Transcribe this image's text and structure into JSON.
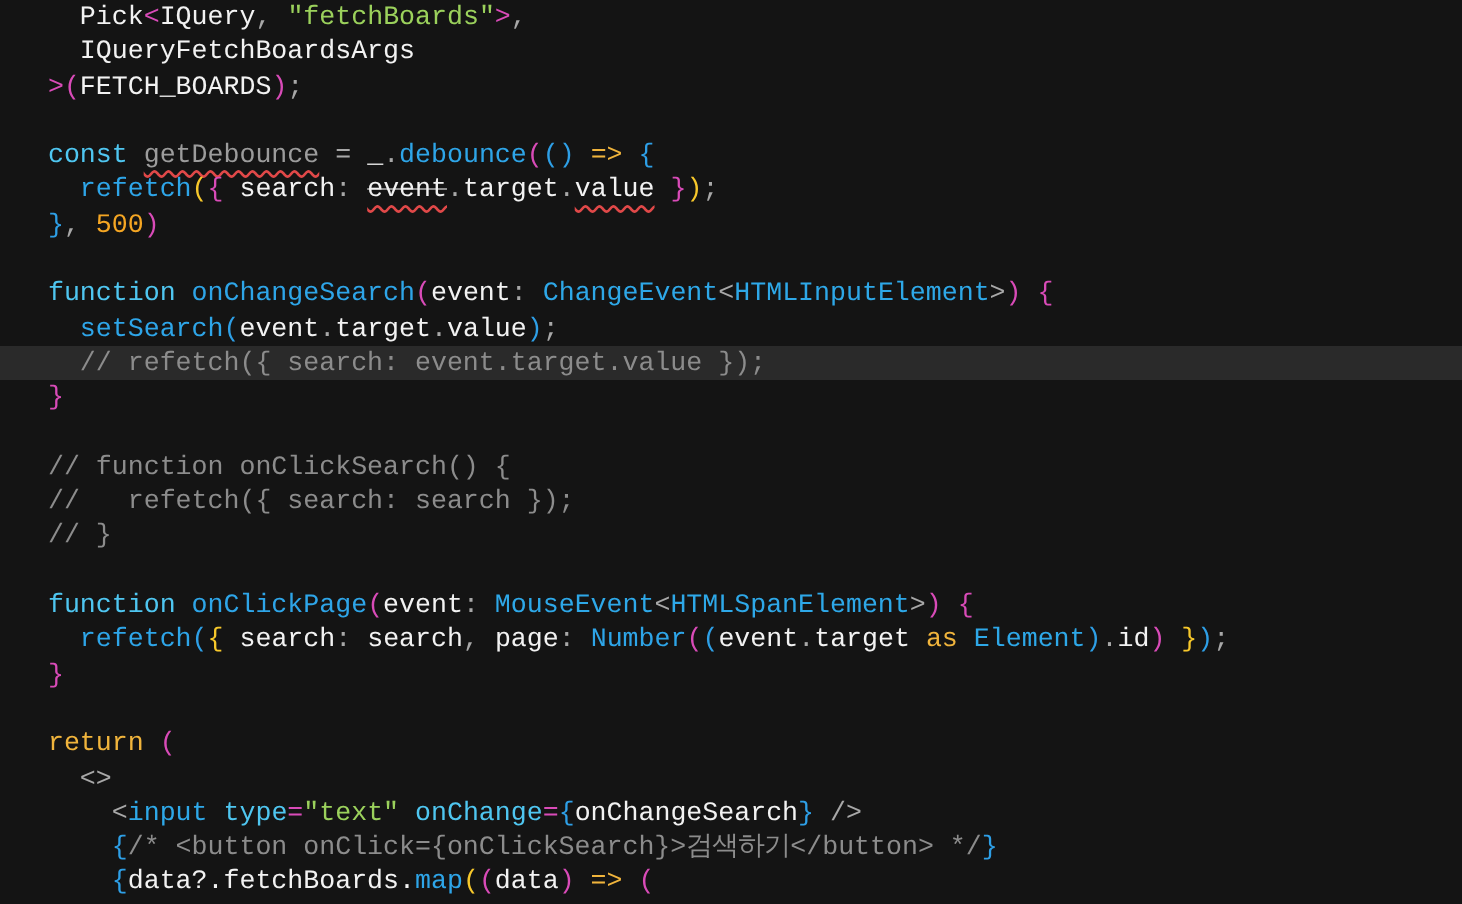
{
  "blocks": [
    {
      "lines": [
        {
          "highlighted": false,
          "tokens": [
            {
              "text": "    Pick",
              "kind": "var"
            },
            {
              "text": "<",
              "kind": "b2"
            },
            {
              "text": "IQuery",
              "kind": "var"
            },
            {
              "text": ", ",
              "kind": "punc"
            },
            {
              "text": "\"fetchBoards\"",
              "kind": "str"
            },
            {
              "text": ">",
              "kind": "b2"
            },
            {
              "text": ",",
              "kind": "punc"
            }
          ]
        },
        {
          "highlighted": false,
          "tokens": [
            {
              "text": "    IQueryFetchBoardsArgs",
              "kind": "var"
            }
          ]
        },
        {
          "highlighted": false,
          "tokens": [
            {
              "text": "  >(",
              "kind": "b2"
            },
            {
              "text": "FETCH_BOARDS",
              "kind": "var"
            },
            {
              "text": ")",
              "kind": "b2"
            },
            {
              "text": ";",
              "kind": "punc"
            }
          ]
        }
      ]
    },
    {
      "lines": [
        {
          "highlighted": false,
          "tokens": [
            {
              "text": "  const ",
              "kind": "kw"
            },
            {
              "text": "getDebounce",
              "kind": "unused",
              "error": true
            },
            {
              "text": " = ",
              "kind": "punc"
            },
            {
              "text": "_",
              "kind": "var"
            },
            {
              "text": ".",
              "kind": "punc"
            },
            {
              "text": "debounce",
              "kind": "fn"
            },
            {
              "text": "(",
              "kind": "b2"
            },
            {
              "text": "()",
              "kind": "b3"
            },
            {
              "text": " => ",
              "kind": "ctl"
            },
            {
              "text": "{",
              "kind": "b3"
            }
          ]
        },
        {
          "highlighted": false,
          "tokens": [
            {
              "text": "    refetch",
              "kind": "fn"
            },
            {
              "text": "(",
              "kind": "b1"
            },
            {
              "text": "{ ",
              "kind": "b2"
            },
            {
              "text": "search",
              "kind": "var"
            },
            {
              "text": ": ",
              "kind": "punc"
            },
            {
              "text": "event",
              "kind": "var",
              "error": true,
              "deprecated": true
            },
            {
              "text": ".",
              "kind": "punc"
            },
            {
              "text": "target",
              "kind": "var"
            },
            {
              "text": ".",
              "kind": "punc"
            },
            {
              "text": "value",
              "kind": "var",
              "error": true
            },
            {
              "text": " }",
              "kind": "b2"
            },
            {
              "text": ")",
              "kind": "b1"
            },
            {
              "text": ";",
              "kind": "punc"
            }
          ]
        },
        {
          "highlighted": false,
          "tokens": [
            {
              "text": "  }",
              "kind": "b3"
            },
            {
              "text": ", ",
              "kind": "punc"
            },
            {
              "text": "500",
              "kind": "num"
            },
            {
              "text": ")",
              "kind": "b2"
            }
          ]
        }
      ]
    },
    {
      "lines": [
        {
          "highlighted": false,
          "tokens": [
            {
              "text": "  function ",
              "kind": "kw"
            },
            {
              "text": "onChangeSearch",
              "kind": "fn"
            },
            {
              "text": "(",
              "kind": "b2"
            },
            {
              "text": "event",
              "kind": "var"
            },
            {
              "text": ": ",
              "kind": "punc"
            },
            {
              "text": "ChangeEvent",
              "kind": "type"
            },
            {
              "text": "<",
              "kind": "punc"
            },
            {
              "text": "HTMLInputElement",
              "kind": "type"
            },
            {
              "text": ">",
              "kind": "punc"
            },
            {
              "text": ") ",
              "kind": "b2"
            },
            {
              "text": "{",
              "kind": "b2"
            }
          ]
        },
        {
          "highlighted": false,
          "tokens": [
            {
              "text": "    setSearch",
              "kind": "fn"
            },
            {
              "text": "(",
              "kind": "b3"
            },
            {
              "text": "event",
              "kind": "var"
            },
            {
              "text": ".",
              "kind": "punc"
            },
            {
              "text": "target",
              "kind": "var"
            },
            {
              "text": ".",
              "kind": "punc"
            },
            {
              "text": "value",
              "kind": "var"
            },
            {
              "text": ")",
              "kind": "b3"
            },
            {
              "text": ";",
              "kind": "punc"
            }
          ]
        },
        {
          "highlighted": true,
          "tokens": [
            {
              "text": "    // refetch({ search: event.target.value });",
              "kind": "com"
            }
          ]
        },
        {
          "highlighted": false,
          "tokens": [
            {
              "text": "  }",
              "kind": "b2"
            }
          ]
        }
      ]
    },
    {
      "lines": [
        {
          "highlighted": false,
          "tokens": [
            {
              "text": "  // function onClickSearch() {",
              "kind": "com"
            }
          ]
        },
        {
          "highlighted": false,
          "tokens": [
            {
              "text": "  //   refetch({ search: search });",
              "kind": "com"
            }
          ]
        },
        {
          "highlighted": false,
          "tokens": [
            {
              "text": "  // }",
              "kind": "com"
            }
          ]
        }
      ]
    },
    {
      "lines": [
        {
          "highlighted": false,
          "tokens": [
            {
              "text": "  function ",
              "kind": "kw"
            },
            {
              "text": "onClickPage",
              "kind": "fn"
            },
            {
              "text": "(",
              "kind": "b2"
            },
            {
              "text": "event",
              "kind": "var"
            },
            {
              "text": ": ",
              "kind": "punc"
            },
            {
              "text": "MouseEvent",
              "kind": "type"
            },
            {
              "text": "<",
              "kind": "punc"
            },
            {
              "text": "HTMLSpanElement",
              "kind": "type"
            },
            {
              "text": ">",
              "kind": "punc"
            },
            {
              "text": ") ",
              "kind": "b2"
            },
            {
              "text": "{",
              "kind": "b2"
            }
          ]
        },
        {
          "highlighted": false,
          "tokens": [
            {
              "text": "    refetch",
              "kind": "fn"
            },
            {
              "text": "(",
              "kind": "b3"
            },
            {
              "text": "{ ",
              "kind": "b1"
            },
            {
              "text": "search",
              "kind": "var"
            },
            {
              "text": ": ",
              "kind": "punc"
            },
            {
              "text": "search",
              "kind": "var"
            },
            {
              "text": ", ",
              "kind": "punc"
            },
            {
              "text": "page",
              "kind": "var"
            },
            {
              "text": ": ",
              "kind": "punc"
            },
            {
              "text": "Number",
              "kind": "fn"
            },
            {
              "text": "(",
              "kind": "b2"
            },
            {
              "text": "(",
              "kind": "b3"
            },
            {
              "text": "event",
              "kind": "var"
            },
            {
              "text": ".",
              "kind": "punc"
            },
            {
              "text": "target ",
              "kind": "var"
            },
            {
              "text": "as ",
              "kind": "ctl"
            },
            {
              "text": "Element",
              "kind": "type"
            },
            {
              "text": ")",
              "kind": "b3"
            },
            {
              "text": ".",
              "kind": "punc"
            },
            {
              "text": "id",
              "kind": "var"
            },
            {
              "text": ")",
              "kind": "b2"
            },
            {
              "text": " }",
              "kind": "b1"
            },
            {
              "text": ")",
              "kind": "b3"
            },
            {
              "text": ";",
              "kind": "punc"
            }
          ]
        },
        {
          "highlighted": false,
          "tokens": [
            {
              "text": "  }",
              "kind": "b2"
            }
          ]
        }
      ]
    },
    {
      "lines": [
        {
          "highlighted": false,
          "tokens": [
            {
              "text": "  return ",
              "kind": "ctl"
            },
            {
              "text": "(",
              "kind": "b2"
            }
          ]
        },
        {
          "highlighted": false,
          "tokens": [
            {
              "text": "    <>",
              "kind": "punc"
            }
          ]
        },
        {
          "highlighted": false,
          "tokens": [
            {
              "text": "      <",
              "kind": "punc"
            },
            {
              "text": "input ",
              "kind": "type"
            },
            {
              "text": "type",
              "kind": "kw"
            },
            {
              "text": "=",
              "kind": "b2"
            },
            {
              "text": "\"text\" ",
              "kind": "str"
            },
            {
              "text": "onChange",
              "kind": "kw"
            },
            {
              "text": "=",
              "kind": "b2"
            },
            {
              "text": "{",
              "kind": "b3"
            },
            {
              "text": "onChangeSearch",
              "kind": "var"
            },
            {
              "text": "}",
              "kind": "b3"
            },
            {
              "text": " />",
              "kind": "punc"
            }
          ]
        },
        {
          "highlighted": false,
          "tokens": [
            {
              "text": "      {",
              "kind": "b3"
            },
            {
              "text": "/* <button onClick={onClickSearch}>검색하기</button> */",
              "kind": "com"
            },
            {
              "text": "}",
              "kind": "b3"
            }
          ]
        },
        {
          "highlighted": false,
          "tokens": [
            {
              "text": "      {",
              "kind": "b3"
            },
            {
              "text": "data?.fetchBoards.",
              "kind": "var"
            },
            {
              "text": "map",
              "kind": "fn"
            },
            {
              "text": "(",
              "kind": "b1"
            },
            {
              "text": "(",
              "kind": "b2"
            },
            {
              "text": "data",
              "kind": "var"
            },
            {
              "text": ")",
              "kind": "b2"
            },
            {
              "text": " => ",
              "kind": "ctl"
            },
            {
              "text": "(",
              "kind": "b2"
            }
          ]
        }
      ]
    }
  ]
}
